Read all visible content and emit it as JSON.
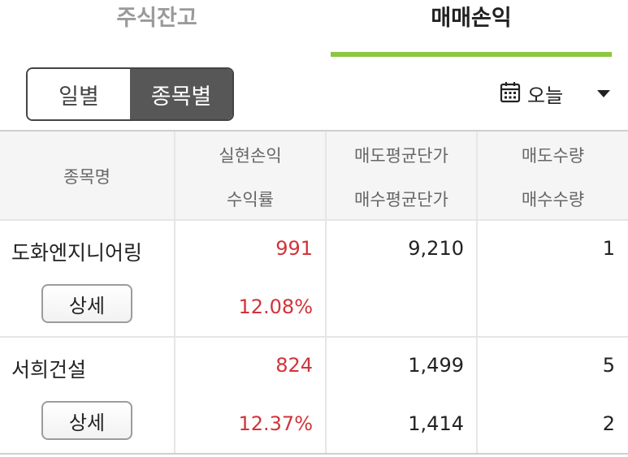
{
  "tabs": [
    {
      "label": "주식잔고",
      "active": false
    },
    {
      "label": "매매손익",
      "active": true
    }
  ],
  "view_toggle": [
    {
      "label": "일별",
      "selected": false
    },
    {
      "label": "종목별",
      "selected": true
    }
  ],
  "period": {
    "label": "오늘",
    "icon": "calendar-icon"
  },
  "table": {
    "headers": {
      "name": "종목명",
      "pnl": "실현손익",
      "rate": "수익률",
      "sell_avg": "매도평균단가",
      "buy_avg": "매수평균단가",
      "sell_qty": "매도수량",
      "buy_qty": "매수수량"
    },
    "rows": [
      {
        "name": "도화엔지니어링",
        "pnl": "991",
        "rate": "12.08%",
        "sell_avg": "9,210",
        "buy_avg": "",
        "sell_qty": "1",
        "buy_qty": "",
        "detail": "상세"
      },
      {
        "name": "서희건설",
        "pnl": "824",
        "rate": "12.37%",
        "sell_avg": "1,499",
        "buy_avg": "1,414",
        "sell_qty": "5",
        "buy_qty": "2",
        "detail": "상세"
      }
    ]
  },
  "colors": {
    "accent": "#8dc63f",
    "profit": "#d0343a",
    "toggle_active": "#575757"
  }
}
